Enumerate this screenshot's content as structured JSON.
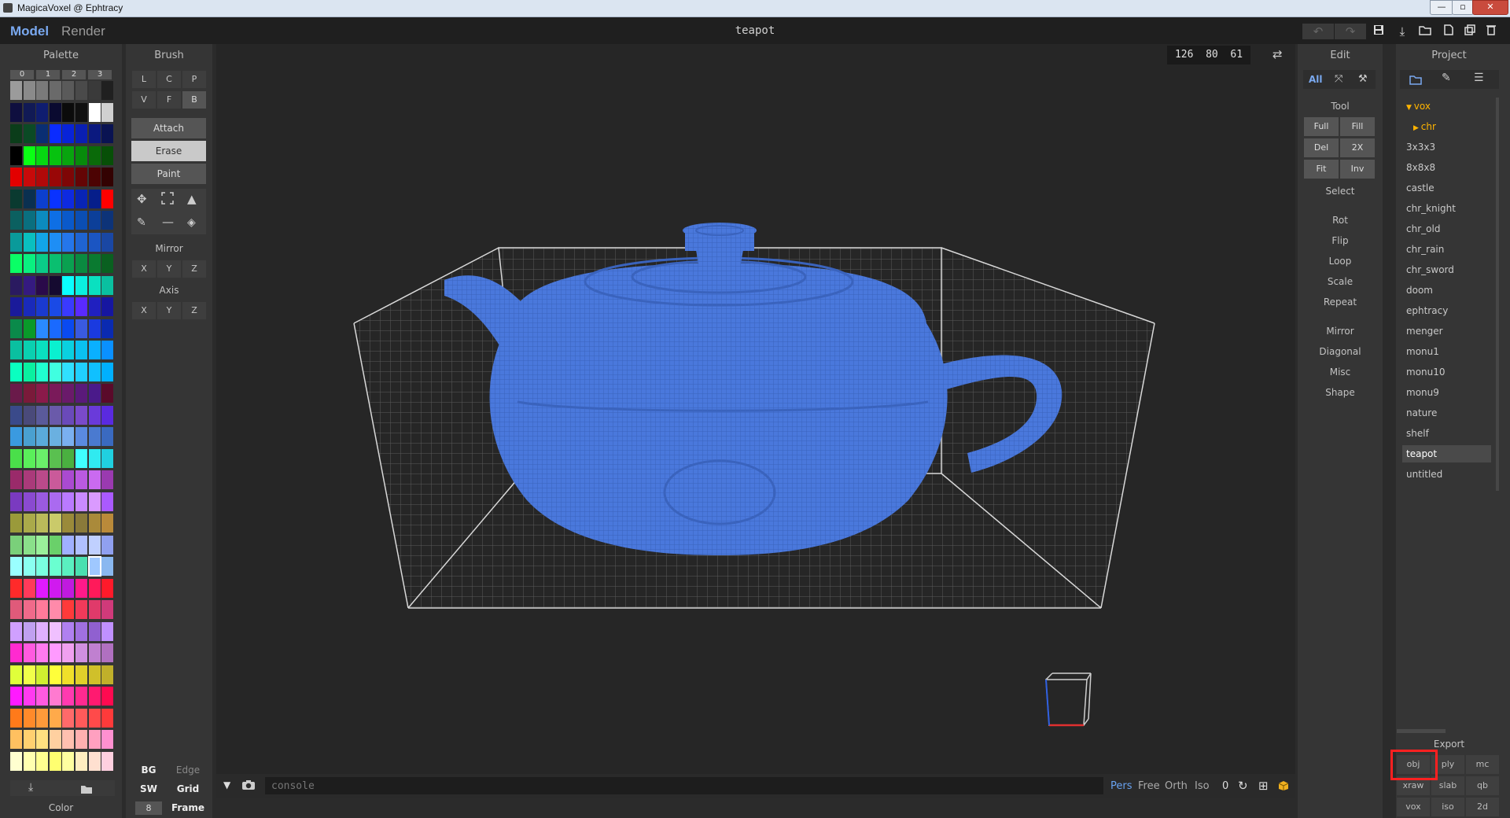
{
  "window": {
    "title": "MagicaVoxel @ Ephtracy",
    "minimize": "—",
    "maximize": "▫",
    "close": "✕"
  },
  "topbar": {
    "tabs": [
      {
        "label": "Model"
      },
      {
        "label": "Render"
      }
    ],
    "doc_title": "teapot",
    "icons": [
      "undo-icon",
      "redo-icon",
      "save-icon",
      "export-icon",
      "open-folder-icon",
      "new-file-icon",
      "duplicate-icon",
      "delete-icon"
    ]
  },
  "palette": {
    "title": "Palette",
    "tabs": [
      "0",
      "1",
      "2",
      "3"
    ],
    "footer_label": "Color",
    "colors": [
      [
        "#9b9b9b",
        "#8a8a8a",
        "#7a7a7a",
        "#6a6a6a",
        "#5a5a5a",
        "#4a4a4a",
        "#3a3a3a",
        "#202020"
      ],
      [
        "#0f0f3f",
        "#111a55",
        "#0f1d70",
        "#0a0a30",
        "#0b0b0b",
        "#101010",
        "#ffffff",
        "#d0d0d0"
      ],
      [
        "#0b3d1a",
        "#0b4a25",
        "#0a2e73",
        "#0b2cff",
        "#0823d8",
        "#0a1fb2",
        "#0b197f",
        "#0a1352"
      ],
      [
        "#000000",
        "#0aff14",
        "#06d811",
        "#07c20f",
        "#08a40e",
        "#078a0b",
        "#0a6a09",
        "#074f07"
      ],
      [
        "#e30000",
        "#c70a0a",
        "#b00909",
        "#990707",
        "#7e0606",
        "#640505",
        "#4c0303",
        "#330202"
      ],
      [
        "#0a3a30",
        "#0a3050",
        "#0c3fce",
        "#0a33ff",
        "#0e2ae0",
        "#0824b5",
        "#061e8a",
        "#ff0000"
      ],
      [
        "#0b6060",
        "#0a6f7f",
        "#0c8bbf",
        "#0e6fe5",
        "#0a59ca",
        "#0b4eb3",
        "#0c3f99",
        "#0d3378"
      ],
      [
        "#0a9a9a",
        "#0abfbf",
        "#12a5e8",
        "#1e8ef5",
        "#2576ea",
        "#1f64d1",
        "#1b55c2",
        "#1a47a3"
      ],
      [
        "#0aff66",
        "#0af080",
        "#0acc88",
        "#0abf70",
        "#0aa050",
        "#0a8a40",
        "#0a7a30",
        "#0a6020"
      ],
      [
        "#2a1a60",
        "#351a80",
        "#2a0a4a",
        "#150a30",
        "#0affff",
        "#0af0e0",
        "#0ae0c0",
        "#0ac0a0"
      ],
      [
        "#1a1a9a",
        "#1a2aba",
        "#1a3ad0",
        "#1a4ae6",
        "#3a3aff",
        "#5a2aff",
        "#2020c0",
        "#1616a0"
      ],
      [
        "#0a8a4a",
        "#0a9a2a",
        "#2a8aff",
        "#1a6aff",
        "#0a4af0",
        "#3a5ae0",
        "#1a3ae0",
        "#0a2ab0"
      ],
      [
        "#0ac0a0",
        "#0ad0b0",
        "#0ae0c0",
        "#0af0d0",
        "#0ad0e0",
        "#0ac0f0",
        "#0ab0ff",
        "#0a90ff"
      ],
      [
        "#0affc0",
        "#0af0a0",
        "#20ffd0",
        "#40ffe0",
        "#30e0ff",
        "#20d0ff",
        "#10c0ff",
        "#00b0ff"
      ],
      [
        "#6a1a4a",
        "#7a1a3a",
        "#8a1a4a",
        "#7a1a5a",
        "#6a1a6a",
        "#5a1a7a",
        "#4a1a8a",
        "#5a0a2a"
      ],
      [
        "#3a4a8a",
        "#4a4a7a",
        "#5a5a9a",
        "#6a5aaa",
        "#6a4aba",
        "#7a4aca",
        "#6a3ada",
        "#5a2ae0"
      ],
      [
        "#3a9ae0",
        "#4aa0d0",
        "#5aaada",
        "#6ab0e0",
        "#7ab0f0",
        "#5a8ae0",
        "#4a7ad0",
        "#3a6ac0"
      ],
      [
        "#4adf4a",
        "#5aef5a",
        "#6aef6a",
        "#5ac050",
        "#4ab040",
        "#40ffff",
        "#30eaf0",
        "#20d0e0"
      ],
      [
        "#9a2a6a",
        "#aa3a7a",
        "#ba4a8a",
        "#ca5a9a",
        "#aa4ad0",
        "#ba5ae0",
        "#ca6af0",
        "#9a3ab0"
      ],
      [
        "#7a3ac0",
        "#8a4ad0",
        "#9a5ae0",
        "#aa6af0",
        "#ba7aff",
        "#ca8aff",
        "#da9aff",
        "#aa5aff"
      ],
      [
        "#9a9a3a",
        "#aaaa4a",
        "#baba5a",
        "#caca6a",
        "#9a8a3a",
        "#8a7a3a",
        "#aa8a3a",
        "#ba8a3a"
      ],
      [
        "#7ad07a",
        "#8ae08a",
        "#9af09a",
        "#6ad06a",
        "#a0b0ff",
        "#b0c0ff",
        "#c0d0ff",
        "#90a0f0"
      ],
      [
        "#9affff",
        "#8afff0",
        "#7affe0",
        "#6affd0",
        "#5af0c0",
        "#4ae0b0",
        "#9fc8ff",
        "#8ab8f0"
      ],
      [
        "#ff2a2a",
        "#ff3a5a",
        "#e01aff",
        "#d01aef",
        "#c01adf",
        "#ff1a8a",
        "#ff1a5a",
        "#ff1a2a"
      ],
      [
        "#e05a7a",
        "#f06a8a",
        "#ff7a9a",
        "#ff8aaa",
        "#ff3a3a",
        "#f03a5a",
        "#e03a6a",
        "#d03a7a"
      ],
      [
        "#d0a0ff",
        "#c0a0f0",
        "#e0b0ff",
        "#f0c0ff",
        "#b080f0",
        "#a070e0",
        "#9060d0",
        "#c090ff"
      ],
      [
        "#ff2ad0",
        "#ff5ae0",
        "#ff7aef",
        "#ff9aff",
        "#f0a0f0",
        "#d090e0",
        "#c080d0",
        "#b070c0"
      ],
      [
        "#e0ff3a",
        "#f0ff4a",
        "#d0f030",
        "#ffff3a",
        "#f0e02a",
        "#e0d02a",
        "#d0c02a",
        "#c0b02a"
      ],
      [
        "#ff1aff",
        "#ff3af0",
        "#ff5ae0",
        "#ff7ad0",
        "#ff3ab0",
        "#ff2a90",
        "#ff1a70",
        "#ff0a50"
      ],
      [
        "#ff7a1a",
        "#ff8a2a",
        "#ff9a3a",
        "#ffaa4a",
        "#ff6a6a",
        "#ff5a5a",
        "#ff4a4a",
        "#ff3a3a"
      ],
      [
        "#ffc060",
        "#ffd070",
        "#ffe080",
        "#ffd0a0",
        "#ffc0b0",
        "#ffb0b0",
        "#ffa0c0",
        "#ff90d0"
      ],
      [
        "#ffffd0",
        "#ffffb0",
        "#ffff90",
        "#ffff70",
        "#ffffa0",
        "#ffeec0",
        "#ffe0d0",
        "#ffd0e0"
      ]
    ]
  },
  "brush": {
    "title": "Brush",
    "modes_row1": [
      "L",
      "C",
      "P"
    ],
    "modes_row2": [
      "V",
      "F",
      "B"
    ],
    "actions": [
      "Attach",
      "Erase",
      "Paint"
    ],
    "mirror": {
      "label": "Mirror",
      "axes": [
        "X",
        "Y",
        "Z"
      ]
    },
    "axis": {
      "label": "Axis",
      "axes": [
        "X",
        "Y",
        "Z"
      ]
    },
    "bottom": {
      "bg": "BG",
      "edge": "Edge",
      "sw": "SW",
      "grid": "Grid",
      "frame_value": "8",
      "frame": "Frame"
    }
  },
  "viewport": {
    "coords": "126  80  61",
    "console_placeholder": "console",
    "view_modes": [
      "Pers",
      "Free",
      "Orth",
      "Iso"
    ],
    "active_view": "Pers",
    "zero": "0",
    "teapot_color": "#4a78dc"
  },
  "edit": {
    "title": "Edit",
    "top_tabs": [
      {
        "label": "All"
      },
      {
        "label": "✕"
      },
      {
        "label": "🔧"
      }
    ],
    "tool_label": "Tool",
    "tool_buttons": [
      [
        "Full",
        "Fill"
      ],
      [
        "Del",
        "2X"
      ],
      [
        "Fit",
        "Inv"
      ]
    ],
    "items": [
      "Select",
      "Rot",
      "Flip",
      "Loop",
      "Scale",
      "Repeat",
      "Mirror",
      "Diagonal",
      "Misc",
      "Shape"
    ]
  },
  "project": {
    "title": "Project",
    "root": "vox",
    "folder": "chr",
    "files": [
      "3x3x3",
      "8x8x8",
      "castle",
      "chr_knight",
      "chr_old",
      "chr_rain",
      "chr_sword",
      "doom",
      "ephtracy",
      "menger",
      "monu1",
      "monu10",
      "monu9",
      "nature",
      "shelf",
      "teapot",
      "untitled"
    ],
    "selected": "teapot",
    "export_label": "Export",
    "export_buttons": [
      [
        "obj",
        "ply",
        "mc"
      ],
      [
        "xraw",
        "slab",
        "qb"
      ],
      [
        "vox",
        "iso",
        "2d"
      ]
    ],
    "highlighted_export": "obj"
  }
}
